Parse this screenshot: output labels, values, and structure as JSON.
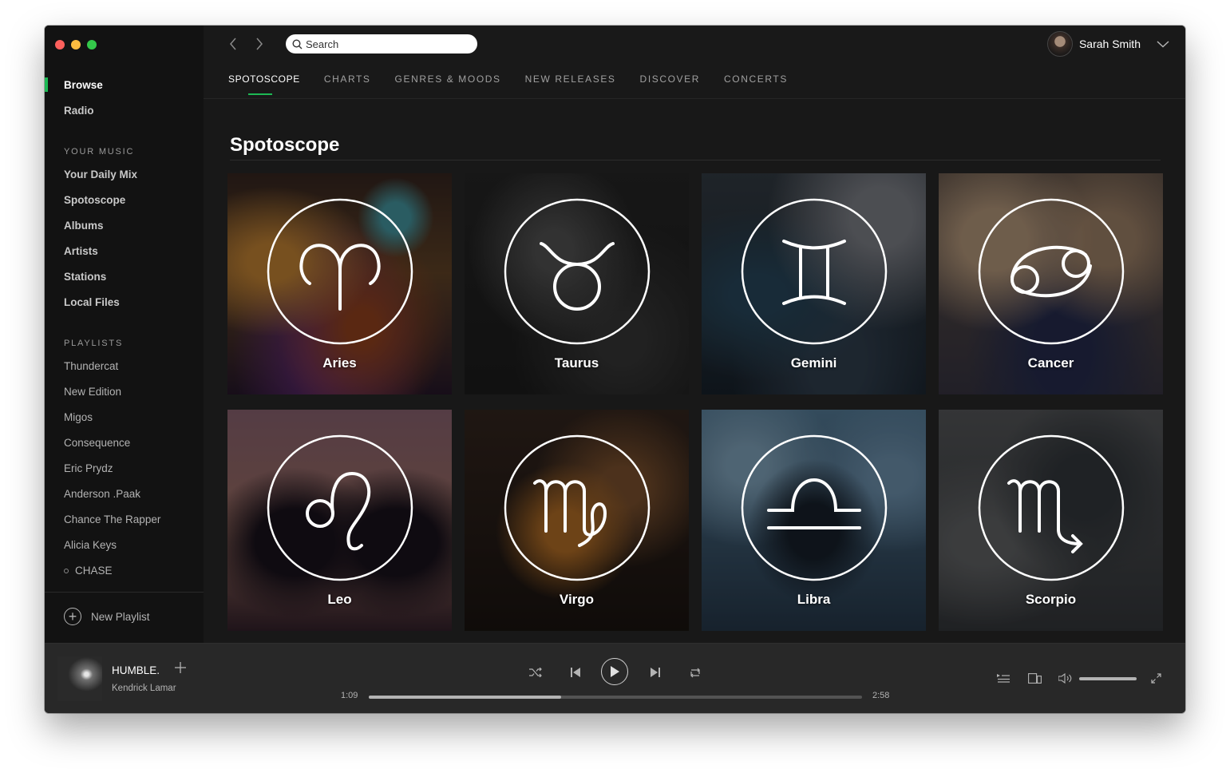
{
  "topbar": {
    "search_placeholder": "Search",
    "user_name": "Sarah Smith",
    "tabs": [
      {
        "label": "SPOTOSCOPE",
        "active": true
      },
      {
        "label": "CHARTS"
      },
      {
        "label": "GENRES & MOODS"
      },
      {
        "label": "NEW RELEASES"
      },
      {
        "label": "DISCOVER"
      },
      {
        "label": "CONCERTS"
      }
    ]
  },
  "sidebar": {
    "main": [
      "Browse",
      "Radio"
    ],
    "your_music_heading": "YOUR MUSIC",
    "your_music": [
      "Your Daily Mix",
      "Spotoscope",
      "Albums",
      "Artists",
      "Stations",
      "Local Files"
    ],
    "playlists_heading": "PLAYLISTS",
    "playlists": [
      "Thundercat",
      "New Edition",
      "Migos",
      "Consequence",
      "Eric Prydz",
      "Anderson .Paak",
      "Chance The Rapper",
      "Alicia Keys",
      "CHASE"
    ],
    "new_playlist": "New Playlist"
  },
  "main": {
    "title": "Spotoscope",
    "cards": [
      {
        "label": "Aries",
        "icon": "aries-icon"
      },
      {
        "label": "Taurus",
        "icon": "taurus-icon"
      },
      {
        "label": "Gemini",
        "icon": "gemini-icon"
      },
      {
        "label": "Cancer",
        "icon": "cancer-icon"
      },
      {
        "label": "Leo",
        "icon": "leo-icon"
      },
      {
        "label": "Virgo",
        "icon": "virgo-icon"
      },
      {
        "label": "Libra",
        "icon": "libra-icon"
      },
      {
        "label": "Scorpio",
        "icon": "scorpio-icon"
      }
    ]
  },
  "player": {
    "track_title": "HUMBLE.",
    "track_artist": "Kendrick Lamar",
    "elapsed": "1:09",
    "duration": "2:58",
    "progress_fraction": 0.39,
    "volume_fraction": 1.0
  },
  "colors": {
    "accent": "#1db954",
    "background": "#121212",
    "main_background": "#181818",
    "player_background": "#282828"
  }
}
